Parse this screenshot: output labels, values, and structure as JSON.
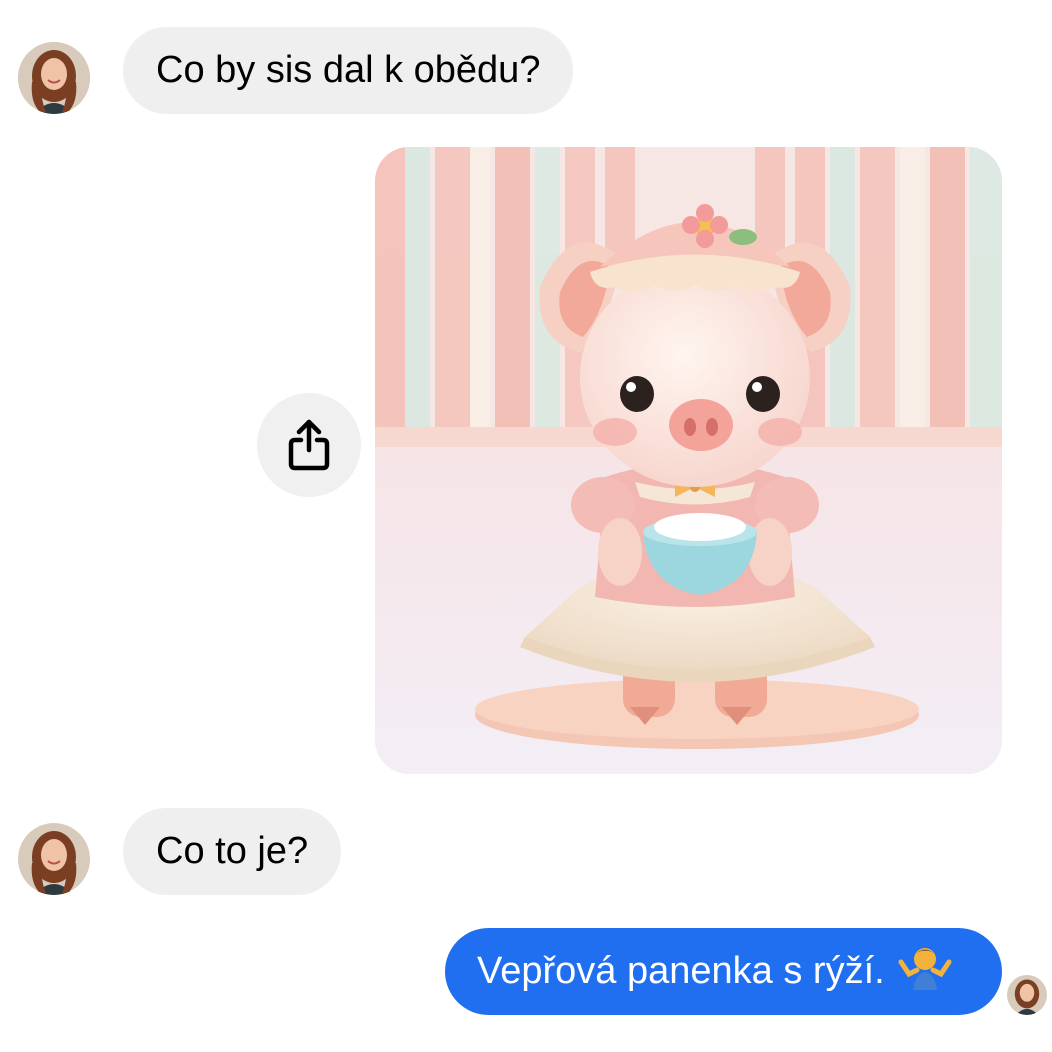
{
  "messages": [
    {
      "direction": "incoming",
      "text": "Co by sis dal k obědu?"
    },
    {
      "direction": "outgoing",
      "type": "image",
      "image_icon": "pig-doll-with-rice-bowl-image"
    },
    {
      "direction": "incoming",
      "text": "Co to je?"
    },
    {
      "direction": "outgoing",
      "text": "Vepřová panenka s rýží.",
      "emoji_icon": "person-shrugging-emoji"
    }
  ],
  "share_button": {
    "icon": "share-icon"
  },
  "colors": {
    "incoming_bubble": "#efefef",
    "outgoing_bubble": "#1f6ff0",
    "share_button_bg": "#f0f0f0"
  }
}
